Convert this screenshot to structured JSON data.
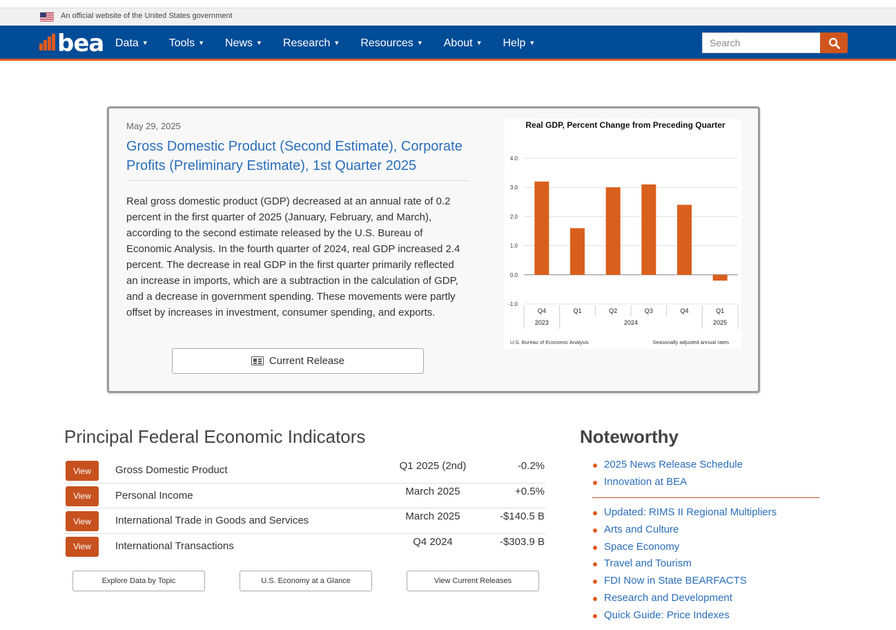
{
  "gov_banner": {
    "text": "An official website of the United States government"
  },
  "header": {
    "logo_text": "bea",
    "nav": [
      "Data",
      "Tools",
      "News",
      "Research",
      "Resources",
      "About",
      "Help"
    ],
    "search_placeholder": "Search"
  },
  "feature": {
    "date": "May 29, 2025",
    "title": "Gross Domestic Product (Second Estimate), Corporate Profits (Preliminary Estimate), 1st Quarter 2025",
    "body": "Real gross domestic product (GDP) decreased at an annual rate of 0.2 percent in the first quarter of 2025 (January, February, and March), according to the second estimate released by the U.S. Bureau of Economic Analysis. In the fourth quarter of 2024, real GDP increased 2.4 percent. The decrease in real GDP in the first quarter primarily reflected an increase in imports, which are a subtraction in the calculation of GDP, and a decrease in government spending. These movements were partly offset by increases in investment, consumer spending, and exports.",
    "button_label": "Current Release"
  },
  "chart_data": {
    "type": "bar",
    "title": "Real GDP, Percent Change from Preceding Quarter",
    "categories": [
      "Q4",
      "Q1",
      "Q2",
      "Q3",
      "Q4",
      "Q1"
    ],
    "year_groups": [
      {
        "label": "2023",
        "span": 1
      },
      {
        "label": "2024",
        "span": 4
      },
      {
        "label": "2025",
        "span": 1
      }
    ],
    "values": [
      3.2,
      1.6,
      3.0,
      3.1,
      2.4,
      -0.2
    ],
    "ylim": [
      -1.0,
      4.0
    ],
    "yticks": [
      "4.0",
      "3.0",
      "2.0",
      "1.0",
      "0.0",
      "-1.0"
    ],
    "grid": true,
    "bar_color": "#d95f1c",
    "source_note": "U.S. Bureau of Economic Analysis",
    "rates_note": "Seasonally adjusted annual rates"
  },
  "indicators": {
    "title": "Principal Federal Economic Indicators",
    "view_label": "View",
    "rows": [
      {
        "name": "Gross Domestic Product",
        "period": "Q1 2025 (2nd)",
        "value": "-0.2%"
      },
      {
        "name": "Personal Income",
        "period": "March 2025",
        "value": "+0.5%"
      },
      {
        "name": "International Trade in Goods and Services",
        "period": "March 2025",
        "value": "-$140.5 B"
      },
      {
        "name": "International Transactions",
        "period": "Q4 2024",
        "value": "-$303.9 B"
      }
    ],
    "buttons": [
      "Explore Data by Topic",
      "U.S. Economy at a Glance",
      "View Current Releases"
    ]
  },
  "noteworthy": {
    "title": "Noteworthy",
    "group1": [
      "2025 News Release Schedule",
      "Innovation at BEA"
    ],
    "group2": [
      "Updated: RIMS II Regional Multipliers",
      "Arts and Culture",
      "Space Economy",
      "Travel and Tourism",
      "FDI Now in State BEARFACTS",
      "Research and Development",
      "Quick Guide: Price Indexes"
    ]
  },
  "colors": {
    "nav_bg": "#004c97",
    "accent": "#e05a1e",
    "link": "#2a6ebb"
  }
}
